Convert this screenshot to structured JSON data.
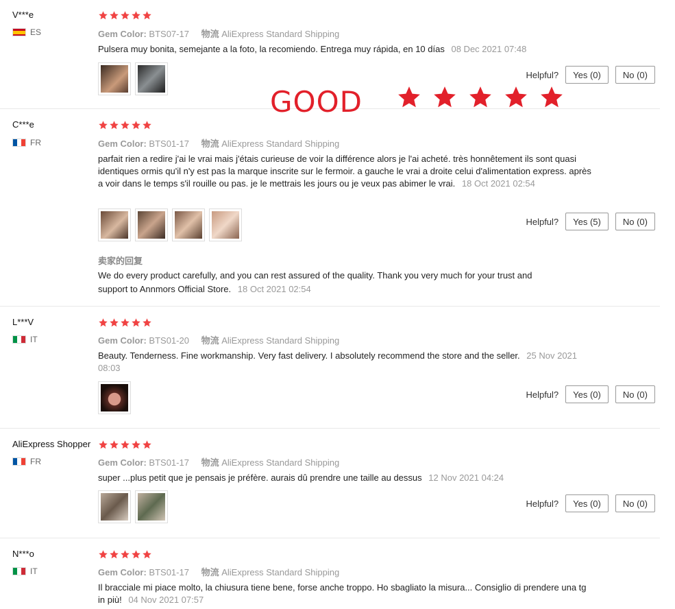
{
  "colors": {
    "star": "#f04343",
    "overlay": "#e2202a"
  },
  "labels": {
    "gem_color": "Gem Color:",
    "shipping_label": "物流",
    "helpful": "Helpful?",
    "seller_reply": "卖家的回复"
  },
  "overlay": {
    "text": "GOOD",
    "stars": 5
  },
  "reviews": [
    {
      "user": "V***e",
      "country": "ES",
      "rating": 5,
      "gem_color": "BTS07-17",
      "shipping": "AliExpress Standard Shipping",
      "text": "Pulsera muy bonita, semejante a la foto, la recomiendo. Entrega muy rápida, en 10 días",
      "date": "08 Dec 2021 07:48",
      "images": 2,
      "yes": "Yes (0)",
      "no": "No (0)"
    },
    {
      "user": "C***e",
      "country": "FR",
      "rating": 5,
      "gem_color": "BTS01-17",
      "shipping": "AliExpress Standard Shipping",
      "text": "parfait rien a redire j'ai le vrai mais j'étais curieuse de voir la différence alors je l'ai acheté. très honnêtement ils sont quasi identiques ormis qu'il n'y est pas la marque inscrite sur le fermoir. a gauche le vrai a droite celui d'alimentation express. après a voir dans le temps s'il rouille ou pas. je le mettrais les jours ou je veux pas abimer le vrai.",
      "date": "18 Oct 2021 02:54",
      "images": 4,
      "yes": "Yes (5)",
      "no": "No (0)",
      "reply": {
        "text": "We do every product carefully, and you can rest assured of the quality. Thank you very much for your trust and support to Annmors Official Store.",
        "date": "18 Oct 2021 02:54"
      }
    },
    {
      "user": "L***V",
      "country": "IT",
      "rating": 5,
      "gem_color": "BTS01-20",
      "shipping": "AliExpress Standard Shipping",
      "text": "Beauty. Tenderness. Fine workmanship. Very fast delivery. I absolutely recommend the store and the seller.",
      "date": "25 Nov 2021 08:03",
      "images": 1,
      "yes": "Yes (0)",
      "no": "No (0)"
    },
    {
      "user": "AliExpress Shopper",
      "country": "FR",
      "rating": 5,
      "gem_color": "BTS01-17",
      "shipping": "AliExpress Standard Shipping",
      "text": "super ...plus petit que je pensais je préfère. aurais dû prendre une taille au dessus",
      "date": "12 Nov 2021 04:24",
      "images": 2,
      "yes": "Yes (0)",
      "no": "No (0)"
    },
    {
      "user": "N***o",
      "country": "IT",
      "rating": 5,
      "gem_color": "BTS01-17",
      "shipping": "AliExpress Standard Shipping",
      "text": "Il bracciale mi piace molto, la chiusura tiene bene, forse anche troppo. Ho sbagliato la misura... Consiglio di prendere una tg in più!",
      "date": "04 Nov 2021 07:57"
    }
  ]
}
